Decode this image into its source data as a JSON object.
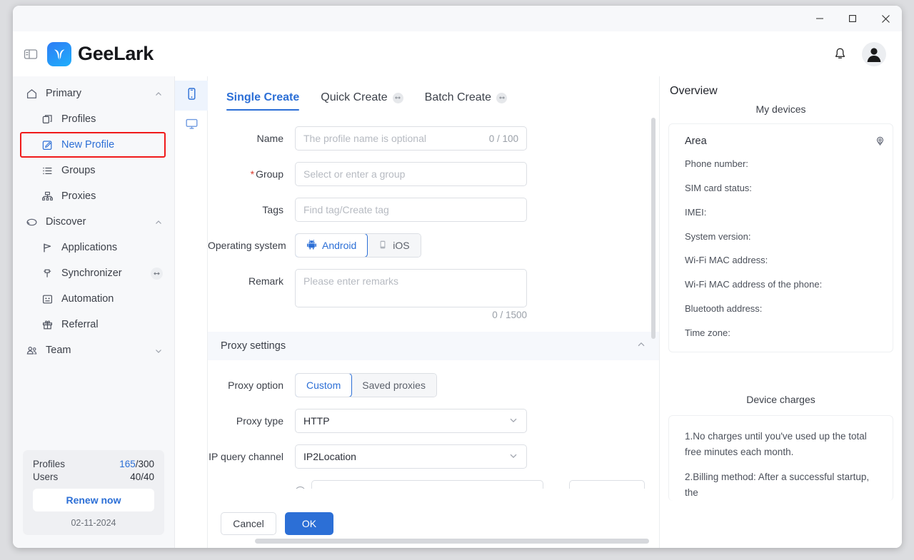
{
  "window": {
    "minimize_label": "Minimize",
    "maximize_label": "Maximize",
    "close_label": "Close"
  },
  "header": {
    "brand": "GeeLark",
    "panel_toggle_name": "panel-toggle-icon",
    "bell_name": "bell-icon",
    "avatar_name": "avatar"
  },
  "sidebar": {
    "groups": [
      {
        "label": "Primary",
        "icon": "home-icon",
        "expanded": true,
        "items": [
          {
            "label": "Profiles",
            "icon": "profiles-icon",
            "active": false,
            "badge": ""
          },
          {
            "label": "New Profile",
            "icon": "edit-square-icon",
            "active": true,
            "badge": ""
          },
          {
            "label": "Groups",
            "icon": "list-icon",
            "active": false,
            "badge": ""
          },
          {
            "label": "Proxies",
            "icon": "network-icon",
            "active": false,
            "badge": ""
          }
        ]
      },
      {
        "label": "Discover",
        "icon": "cloud-icon",
        "expanded": true,
        "items": [
          {
            "label": "Applications",
            "icon": "apps-icon",
            "active": false,
            "badge": ""
          },
          {
            "label": "Synchronizer",
            "icon": "sync-icon",
            "active": false,
            "badge": "arrows-icon"
          },
          {
            "label": "Automation",
            "icon": "automation-icon",
            "active": false,
            "badge": ""
          },
          {
            "label": "Referral",
            "icon": "gift-icon",
            "active": false,
            "badge": ""
          }
        ]
      },
      {
        "label": "Team",
        "icon": "team-icon",
        "expanded": false,
        "items": []
      }
    ],
    "quota": {
      "profiles_label": "Profiles",
      "profiles_used": "165",
      "profiles_total": "/300",
      "users_label": "Users",
      "users_value": "40/40",
      "renew_label": "Renew now",
      "date": "02-11-2024"
    }
  },
  "rail": {
    "items": [
      {
        "name": "phone-icon",
        "selected": true
      },
      {
        "name": "desktop-icon",
        "selected": false
      }
    ]
  },
  "tabs": [
    {
      "label": "Single Create",
      "active": true,
      "badge": false
    },
    {
      "label": "Quick Create",
      "active": false,
      "badge": true
    },
    {
      "label": "Batch Create",
      "active": false,
      "badge": true
    }
  ],
  "form": {
    "name": {
      "label": "Name",
      "placeholder": "The profile name is optional",
      "value": "",
      "counter": "0 / 100"
    },
    "group": {
      "label": "Group",
      "required": "*",
      "placeholder": "Select or enter a group",
      "value": ""
    },
    "tags": {
      "label": "Tags",
      "placeholder": "Find tag/Create tag",
      "value": ""
    },
    "os": {
      "label": "Operating system",
      "options": [
        {
          "label": "Android",
          "selected": true,
          "icon": "android-icon"
        },
        {
          "label": "iOS",
          "selected": false,
          "icon": "ios-phone-icon"
        }
      ]
    },
    "remark": {
      "label": "Remark",
      "placeholder": "Please enter remarks",
      "value": "",
      "counter": "0 / 1500"
    }
  },
  "proxy": {
    "section_title": "Proxy settings",
    "option": {
      "label": "Proxy option",
      "options": [
        {
          "label": "Custom",
          "selected": true
        },
        {
          "label": "Saved proxies",
          "selected": false
        }
      ]
    },
    "type": {
      "label": "Proxy type",
      "value": "HTTP"
    },
    "ip_channel": {
      "label": "IP query channel",
      "value": "IP2Location"
    }
  },
  "footer": {
    "cancel_label": "Cancel",
    "ok_label": "OK"
  },
  "overview": {
    "title": "Overview",
    "devices_heading": "My devices",
    "area_label": "Area",
    "fields": [
      "Phone number:",
      "SIM card status:",
      "IMEI:",
      "System version:",
      "Wi-Fi MAC address:",
      "Wi-Fi MAC address of the phone:",
      "Bluetooth address:",
      "Time zone:"
    ],
    "charges_heading": "Device charges",
    "charges": [
      "1.No charges until you've used up the total free minutes each month.",
      "2.Billing method: After a successful startup, the"
    ]
  },
  "colors": {
    "accent": "#2c6fd6",
    "highlight": "#f01a1a",
    "required": "#d8392b",
    "sidebar_bg": "#f7f8fa"
  }
}
